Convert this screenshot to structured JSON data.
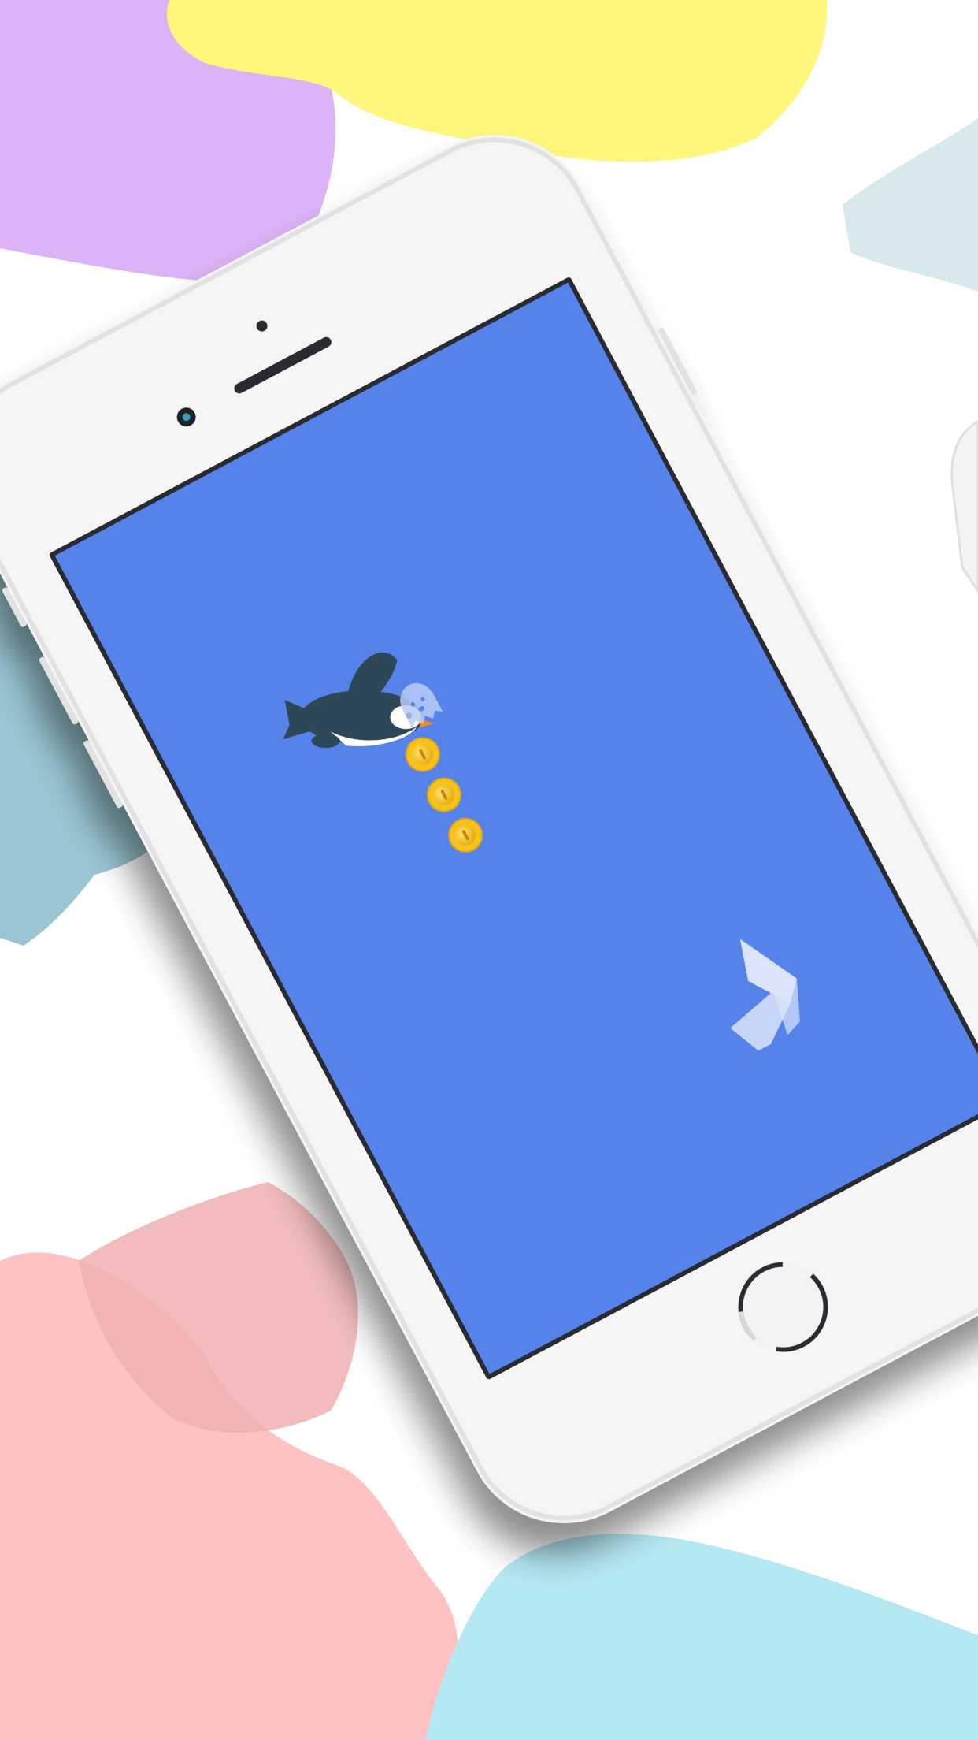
{
  "scene": {
    "background_color": "#ffffff",
    "blob_colors": {
      "purple": "#dbb3f6",
      "yellow": "#fef77c",
      "pink": "#fdc2c1",
      "cyan": "#b4e8f2",
      "teal_brush": "#8ec0cd",
      "pink_brush": "#f0b0b0"
    }
  },
  "phone": {
    "body_color": "#f5f5f5",
    "bezel_edge_color": "#e2e2e2",
    "screen_frame_color": "#2b2b30",
    "speaker": "speaker-grille",
    "front_camera": "front-camera-icon",
    "home_button": "home-button"
  },
  "game": {
    "screen_color": "#5583ea",
    "player": {
      "icon": "penguin-icon",
      "body_color": "#2e4756",
      "belly_color": "#ffffff",
      "beak_color": "#f08a1c"
    },
    "ghost": {
      "icon": "ghost-icon",
      "color": "#b9cbf7"
    },
    "coins": {
      "icon": "coin-icon",
      "count": 3,
      "color": "#f6c21a"
    },
    "logo": {
      "icon": "game-logo-icon",
      "color": "#e7edfc"
    }
  }
}
